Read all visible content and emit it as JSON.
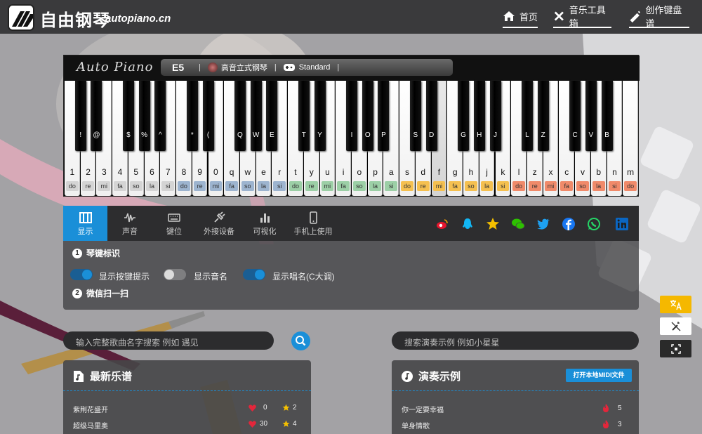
{
  "site": {
    "name": "自由钢琴",
    "domain": "autopiano.cn"
  },
  "nav": [
    {
      "label": "首页",
      "icon": "home-icon"
    },
    {
      "label": "音乐工具箱",
      "icon": "tools-icon"
    },
    {
      "label": "创作键盘谱",
      "icon": "compose-icon"
    }
  ],
  "piano": {
    "brand": "Auto Piano",
    "note": "E5",
    "instrument": "高音立式钢琴",
    "mode": "Standard"
  },
  "keys": {
    "white": [
      {
        "k": "1",
        "s": "do",
        "c": "#d4d4d4"
      },
      {
        "k": "2",
        "s": "re",
        "c": "#d4d4d4"
      },
      {
        "k": "3",
        "s": "mi",
        "c": "#d4d4d4"
      },
      {
        "k": "4",
        "s": "fa",
        "c": "#d4d4d4"
      },
      {
        "k": "5",
        "s": "so",
        "c": "#d4d4d4"
      },
      {
        "k": "6",
        "s": "la",
        "c": "#d4d4d4"
      },
      {
        "k": "7",
        "s": "si",
        "c": "#d4d4d4"
      },
      {
        "k": "8",
        "s": "do",
        "c": "#9db4cf"
      },
      {
        "k": "9",
        "s": "re",
        "c": "#9db4cf"
      },
      {
        "k": "0",
        "s": "mi",
        "c": "#9db4cf"
      },
      {
        "k": "q",
        "s": "fa",
        "c": "#9db4cf"
      },
      {
        "k": "w",
        "s": "so",
        "c": "#9db4cf"
      },
      {
        "k": "e",
        "s": "la",
        "c": "#9db4cf"
      },
      {
        "k": "r",
        "s": "si",
        "c": "#9db4cf"
      },
      {
        "k": "t",
        "s": "do",
        "c": "#9ccfa6"
      },
      {
        "k": "y",
        "s": "re",
        "c": "#9ccfa6"
      },
      {
        "k": "u",
        "s": "mi",
        "c": "#9ccfa6"
      },
      {
        "k": "i",
        "s": "fa",
        "c": "#9ccfa6"
      },
      {
        "k": "o",
        "s": "so",
        "c": "#9ccfa6"
      },
      {
        "k": "p",
        "s": "la",
        "c": "#9ccfa6"
      },
      {
        "k": "a",
        "s": "si",
        "c": "#9ccfa6"
      },
      {
        "k": "s",
        "s": "do",
        "c": "#f5c050"
      },
      {
        "k": "d",
        "s": "re",
        "c": "#f5c050"
      },
      {
        "k": "f",
        "s": "mi",
        "c": "#f5c050"
      },
      {
        "k": "g",
        "s": "fa",
        "c": "#f5c050"
      },
      {
        "k": "h",
        "s": "so",
        "c": "#f5c050"
      },
      {
        "k": "j",
        "s": "la",
        "c": "#f5c050"
      },
      {
        "k": "k",
        "s": "si",
        "c": "#f5c050"
      },
      {
        "k": "l",
        "s": "do",
        "c": "#f08a6a"
      },
      {
        "k": "z",
        "s": "re",
        "c": "#f08a6a"
      },
      {
        "k": "x",
        "s": "mi",
        "c": "#f08a6a"
      },
      {
        "k": "c",
        "s": "fa",
        "c": "#f08a6a"
      },
      {
        "k": "v",
        "s": "so",
        "c": "#f08a6a"
      },
      {
        "k": "b",
        "s": "la",
        "c": "#f08a6a"
      },
      {
        "k": "n",
        "s": "si",
        "c": "#f08a6a"
      },
      {
        "k": "m",
        "s": "do",
        "c": "#f08a6a"
      }
    ],
    "black": [
      {
        "k": "!",
        "after": 0
      },
      {
        "k": "@",
        "after": 1
      },
      {
        "k": "$",
        "after": 3
      },
      {
        "k": "%",
        "after": 4
      },
      {
        "k": "^",
        "after": 5
      },
      {
        "k": "*",
        "after": 7
      },
      {
        "k": "(",
        "after": 8
      },
      {
        "k": "Q",
        "after": 10
      },
      {
        "k": "W",
        "after": 11
      },
      {
        "k": "E",
        "after": 12
      },
      {
        "k": "T",
        "after": 14
      },
      {
        "k": "Y",
        "after": 15
      },
      {
        "k": "I",
        "after": 17
      },
      {
        "k": "O",
        "after": 18
      },
      {
        "k": "P",
        "after": 19
      },
      {
        "k": "S",
        "after": 21
      },
      {
        "k": "D",
        "after": 22
      },
      {
        "k": "G",
        "after": 24
      },
      {
        "k": "H",
        "after": 25
      },
      {
        "k": "J",
        "after": 26
      },
      {
        "k": "L",
        "after": 28
      },
      {
        "k": "Z",
        "after": 29
      },
      {
        "k": "C",
        "after": 31
      },
      {
        "k": "V",
        "after": 32
      },
      {
        "k": "B",
        "after": 33
      }
    ],
    "active_index": 23
  },
  "tabs": [
    {
      "label": "显示",
      "icon": "piano-icon"
    },
    {
      "label": "声音",
      "icon": "waveform-icon"
    },
    {
      "label": "键位",
      "icon": "keyboard-icon"
    },
    {
      "label": "外接设备",
      "icon": "plug-icon"
    },
    {
      "label": "可视化",
      "icon": "bars-icon"
    },
    {
      "label": "手机上使用",
      "icon": "phone-icon"
    }
  ],
  "social": [
    {
      "icon": "weibo-icon",
      "color": "#e6162d"
    },
    {
      "icon": "qq-icon",
      "color": "#12b7f5"
    },
    {
      "icon": "qzone-icon",
      "color": "#f5c000"
    },
    {
      "icon": "wechat-icon",
      "color": "#2dc100"
    },
    {
      "icon": "twitter-icon",
      "color": "#1da1f2"
    },
    {
      "icon": "facebook-icon",
      "color": "#1877f2"
    },
    {
      "icon": "whatsapp-icon",
      "color": "#25d366"
    },
    {
      "icon": "linkedin-icon",
      "color": "#0a66c2"
    }
  ],
  "display": {
    "section1": {
      "num": "1",
      "title": "琴键标识"
    },
    "section2": {
      "num": "2",
      "title": "微信扫一扫"
    },
    "toggles": [
      {
        "label": "显示按键提示",
        "on": true
      },
      {
        "label": "显示音名",
        "on": false
      },
      {
        "label": "显示唱名(C大调)",
        "on": true
      }
    ]
  },
  "search": {
    "song_placeholder": "输入完整歌曲名字搜索  例如 遇见",
    "demo_placeholder": "搜索演奏示例  例如小星星"
  },
  "latest": {
    "title": "最新乐谱",
    "rows": [
      {
        "name": "紫荆花盛开",
        "likes": "0",
        "stars": "2"
      },
      {
        "name": "超级马里奥",
        "likes": "30",
        "stars": "4"
      }
    ]
  },
  "demos": {
    "title": "演奏示例",
    "button": "打开本地MIDI文件",
    "rows": [
      {
        "name": "你一定要幸福",
        "hot": "5"
      },
      {
        "name": "单身情歌",
        "hot": "3"
      }
    ]
  },
  "sidebar": [
    {
      "icon": "translate-icon",
      "color": "#f5b800"
    },
    {
      "icon": "magic-off-icon",
      "color": "#ffffff"
    },
    {
      "icon": "fullscreen-icon",
      "color": "#2a2a2a"
    }
  ]
}
